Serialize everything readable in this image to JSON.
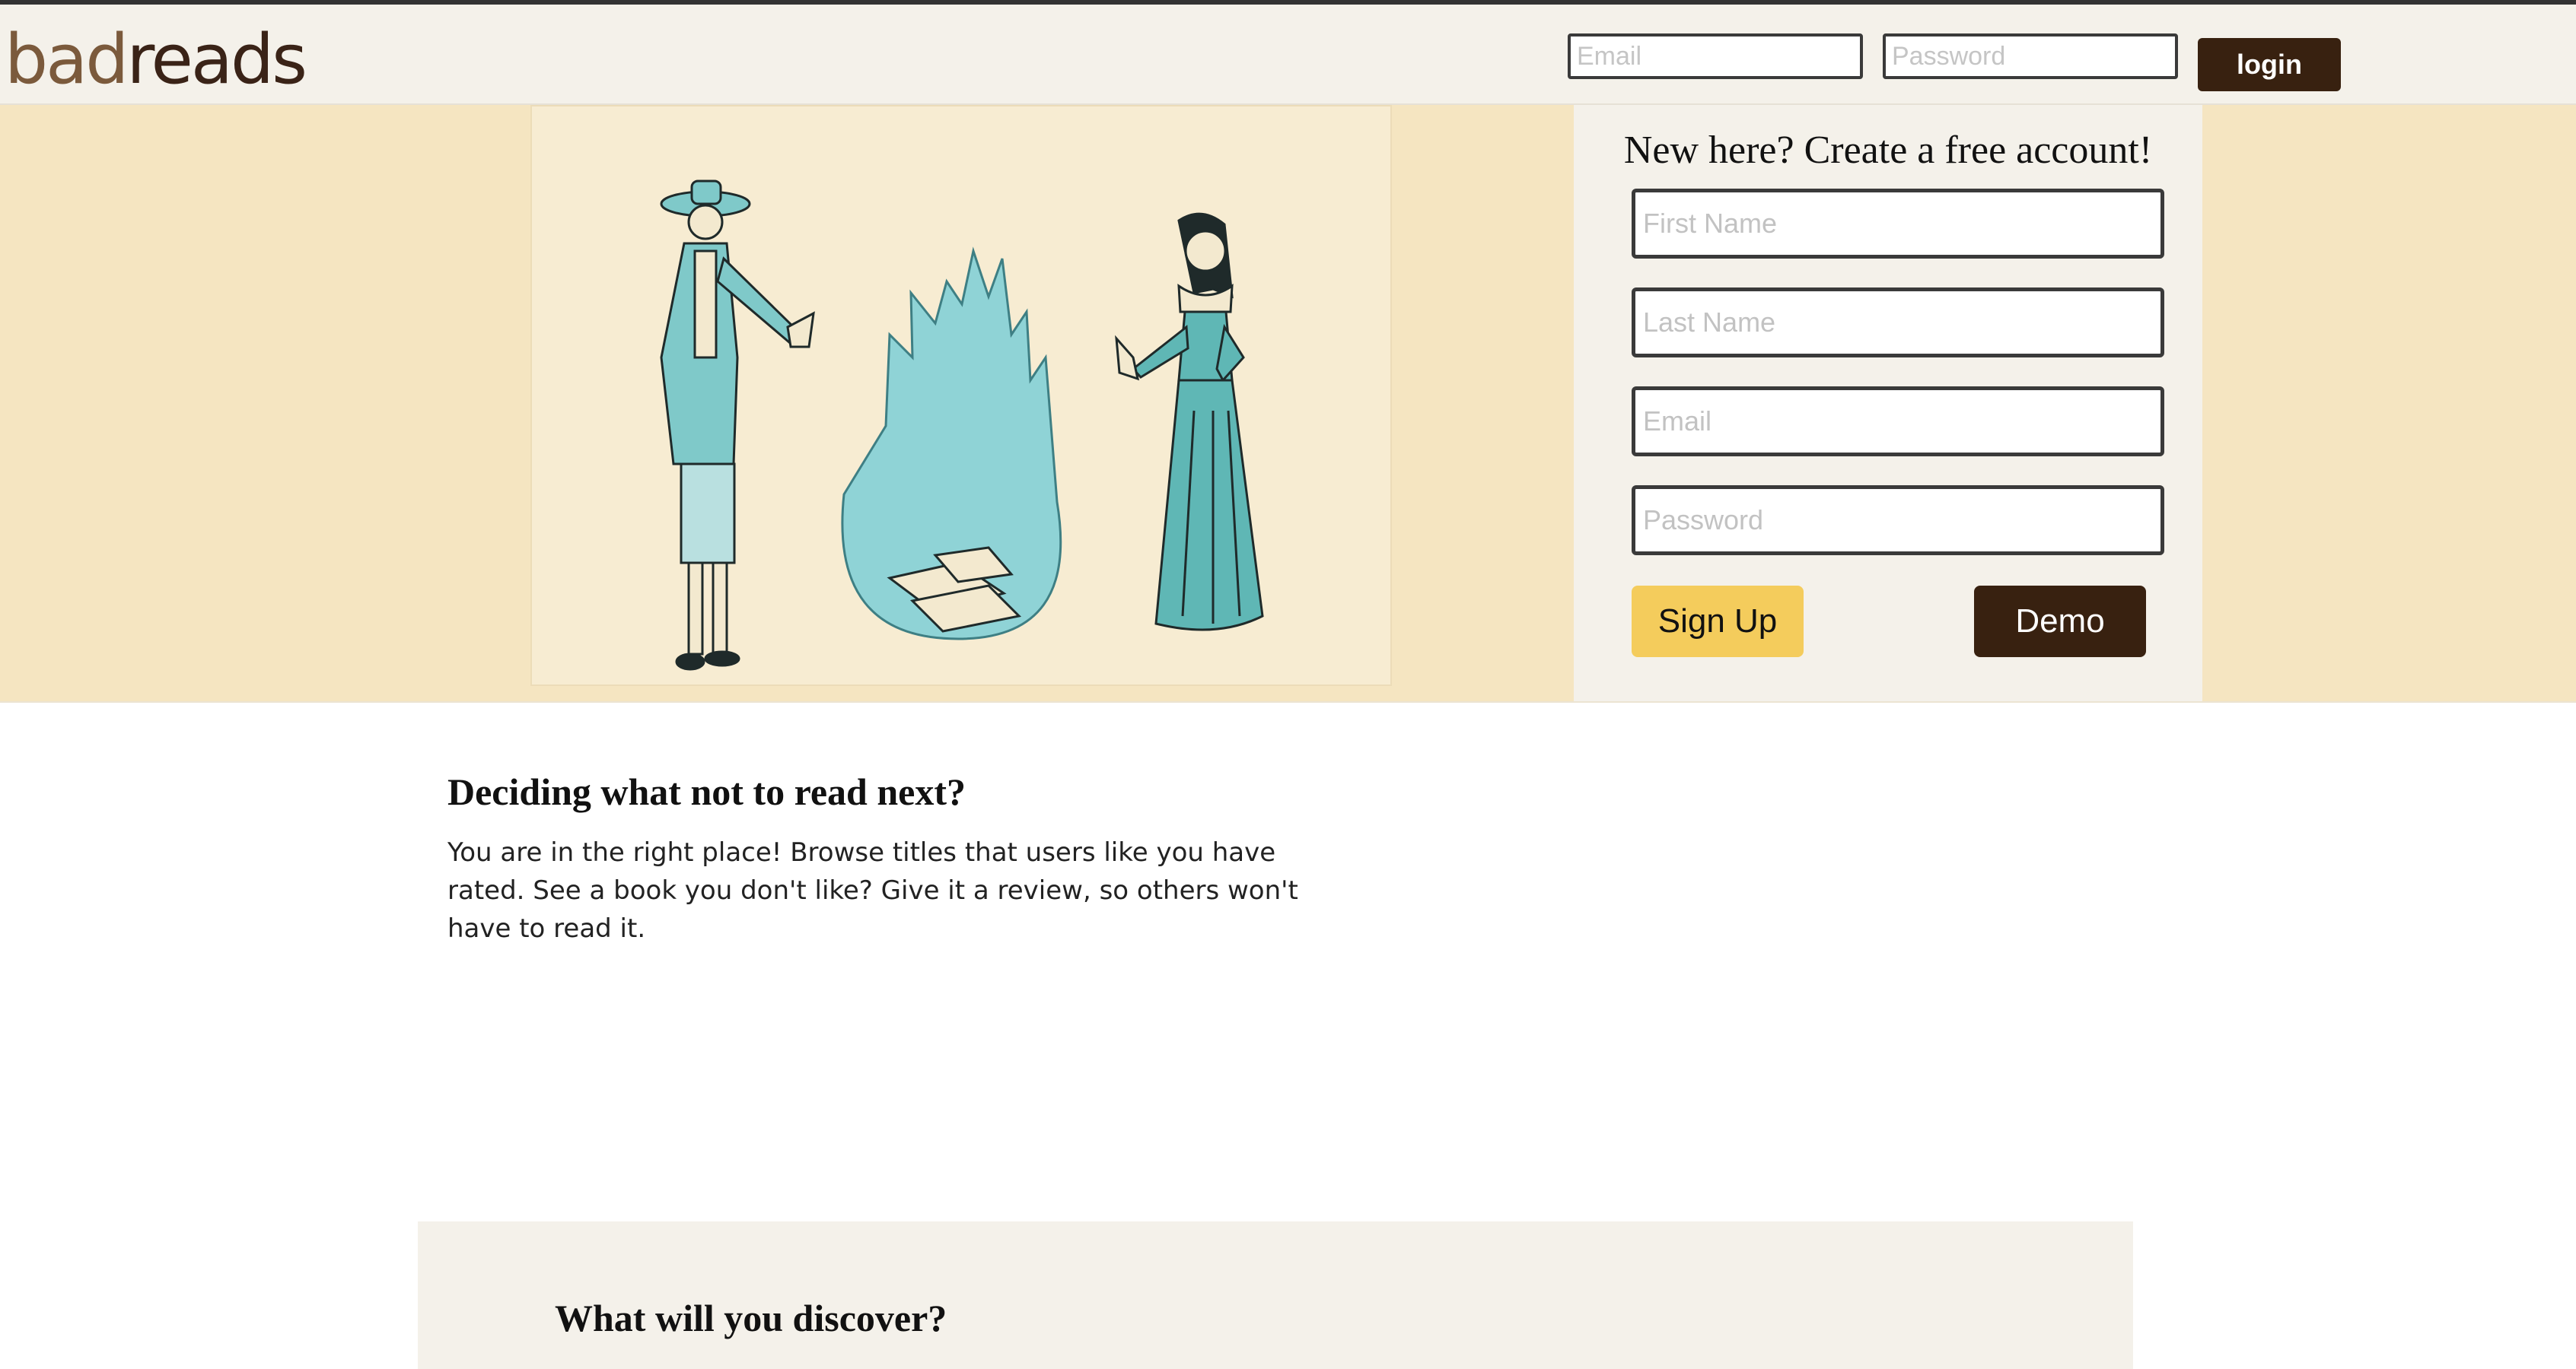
{
  "header": {
    "logo_bad": "bad",
    "logo_reads": "reads",
    "email_placeholder": "Email",
    "password_placeholder": "Password",
    "login_label": "login"
  },
  "signup": {
    "title": "New here? Create a free account!",
    "first_name_placeholder": "First Name",
    "last_name_placeholder": "Last Name",
    "email_placeholder": "Email",
    "password_placeholder": "Password",
    "signup_label": "Sign Up",
    "demo_label": "Demo"
  },
  "intro": {
    "title": "Deciding what not to read next?",
    "text": "You are in the right place! Browse titles that users like you have rated. See a book you don't like? Give it a review, so others won't have to read it."
  },
  "discover": {
    "title": "What will you discover?"
  },
  "colors": {
    "brand_dark": "#382110",
    "accent_yellow": "#f4cc5c",
    "hero_bg": "#f5e5c1",
    "panel_bg": "#f4f1ea",
    "illustration_teal": "#7fc9c9"
  }
}
